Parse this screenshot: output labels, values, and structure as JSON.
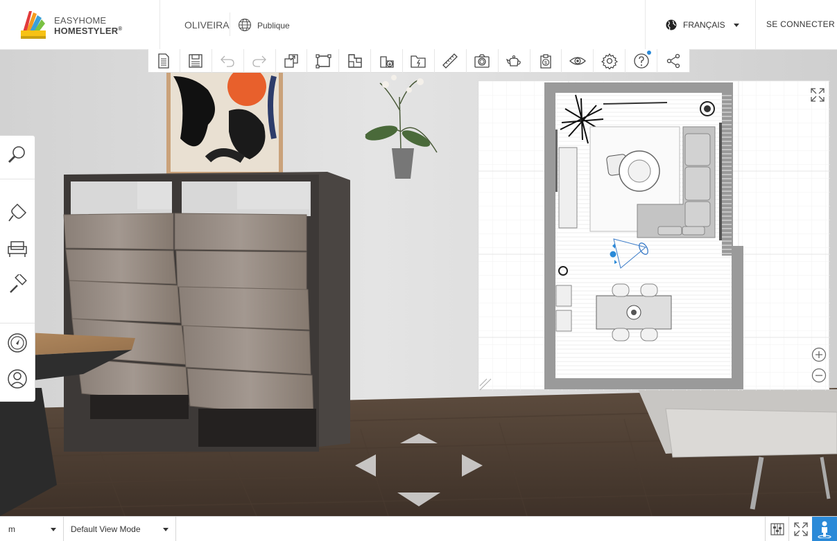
{
  "header": {
    "brand_line1": "EASYHOME",
    "brand_line2": "HOMESTYLER",
    "brand_mark": "®",
    "project_name": "OLIVEIRA",
    "visibility": "Publique",
    "language": "FRANÇAIS",
    "login_label": "SE CONNECTER"
  },
  "toolbar": {
    "buttons": [
      "new-file-icon",
      "save-icon",
      "undo-icon",
      "redo-icon",
      "copy-icon",
      "floor-plan-icon",
      "room-shape-icon",
      "import-icon",
      "folder-icon",
      "ruler-icon",
      "camera-icon",
      "teapot-icon",
      "price-tag-icon",
      "eye-icon",
      "gear-icon",
      "help-icon",
      "share-icon"
    ]
  },
  "left_panel": {
    "buttons": [
      "search-icon",
      "shovel-icon",
      "armchair-icon",
      "paint-roller-icon",
      "compass-icon",
      "user-icon"
    ]
  },
  "minimap": {
    "controls": [
      "expand-icon",
      "zoom-in-icon",
      "zoom-out-icon"
    ]
  },
  "navigation": {
    "arrows": [
      "arrow-up-icon",
      "arrow-left-icon",
      "arrow-right-icon",
      "arrow-down-icon"
    ]
  },
  "bottom_bar": {
    "unit": "m",
    "view_mode": "Default View Mode",
    "buttons": [
      "level-adjust-icon",
      "fullscreen-icon",
      "walk-mode-icon"
    ]
  },
  "colors": {
    "accent": "#2b8ad8",
    "walk_button": "#2b8ad8"
  }
}
